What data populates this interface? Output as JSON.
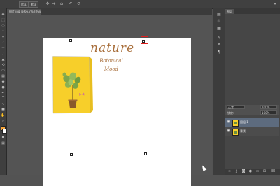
{
  "menubar": {
    "buttons": [
      "默认",
      "默认"
    ],
    "icons": [
      "move-icon",
      "arrow-icon",
      "home-icon",
      "undo-icon",
      "rotate-icon",
      "more-icon"
    ]
  },
  "document": {
    "tab_label": "图片.jpg @ 66.7% (RGB/8)"
  },
  "poster": {
    "title": "nature",
    "subtitle_line1": "Botanical",
    "subtitle_line2": "Mood",
    "background_color": "#f7cf2a",
    "text_color": "#a86e3a"
  },
  "colors": {
    "foreground": "#f2a33a",
    "background": "#ffffff",
    "highlight": "#e02020"
  },
  "panels": {
    "tabs": [
      "图层"
    ],
    "mode_label": "正常",
    "opacity_value": "100%",
    "lock_label": "锁定:",
    "fill_value": "100%",
    "layers": [
      {
        "name": "图层 1",
        "active": true
      },
      {
        "name": "背景",
        "active": false
      }
    ],
    "footer_icons": [
      "link-icon",
      "fx-icon",
      "mask-icon",
      "adjust-icon",
      "folder-icon",
      "new-layer-icon",
      "trash-icon"
    ]
  }
}
